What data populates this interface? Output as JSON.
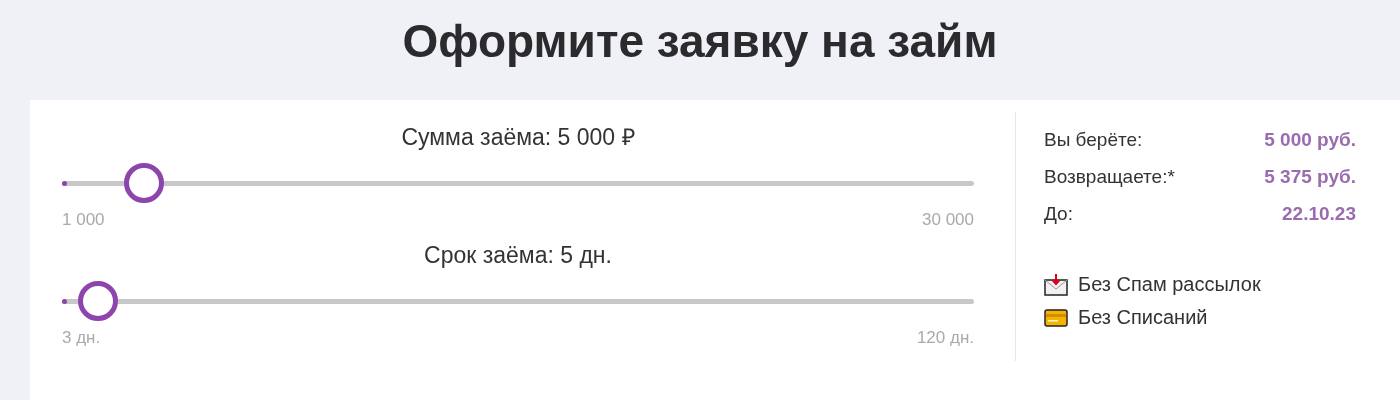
{
  "title": "Оформите заявку на займ",
  "sliders": [
    {
      "label": "Сумма заёма: 5 000 ₽",
      "level": 0.09,
      "min": "1 000",
      "max": "30 000"
    },
    {
      "label": "Срок заёма: 5 дн.",
      "level": 0.04,
      "min": "3 дн.",
      "max": "120 дн."
    }
  ],
  "summary": [
    {
      "label": "Вы берёте:",
      "value": "5 000 руб."
    },
    {
      "label": "Возвращаете:*",
      "value": "5 375 руб."
    },
    {
      "label": "До:",
      "value": "22.10.23"
    }
  ],
  "features": [
    {
      "kind": "mail",
      "label": "Без Спам рассылок"
    },
    {
      "kind": "card",
      "label": "Без Списаний"
    }
  ]
}
